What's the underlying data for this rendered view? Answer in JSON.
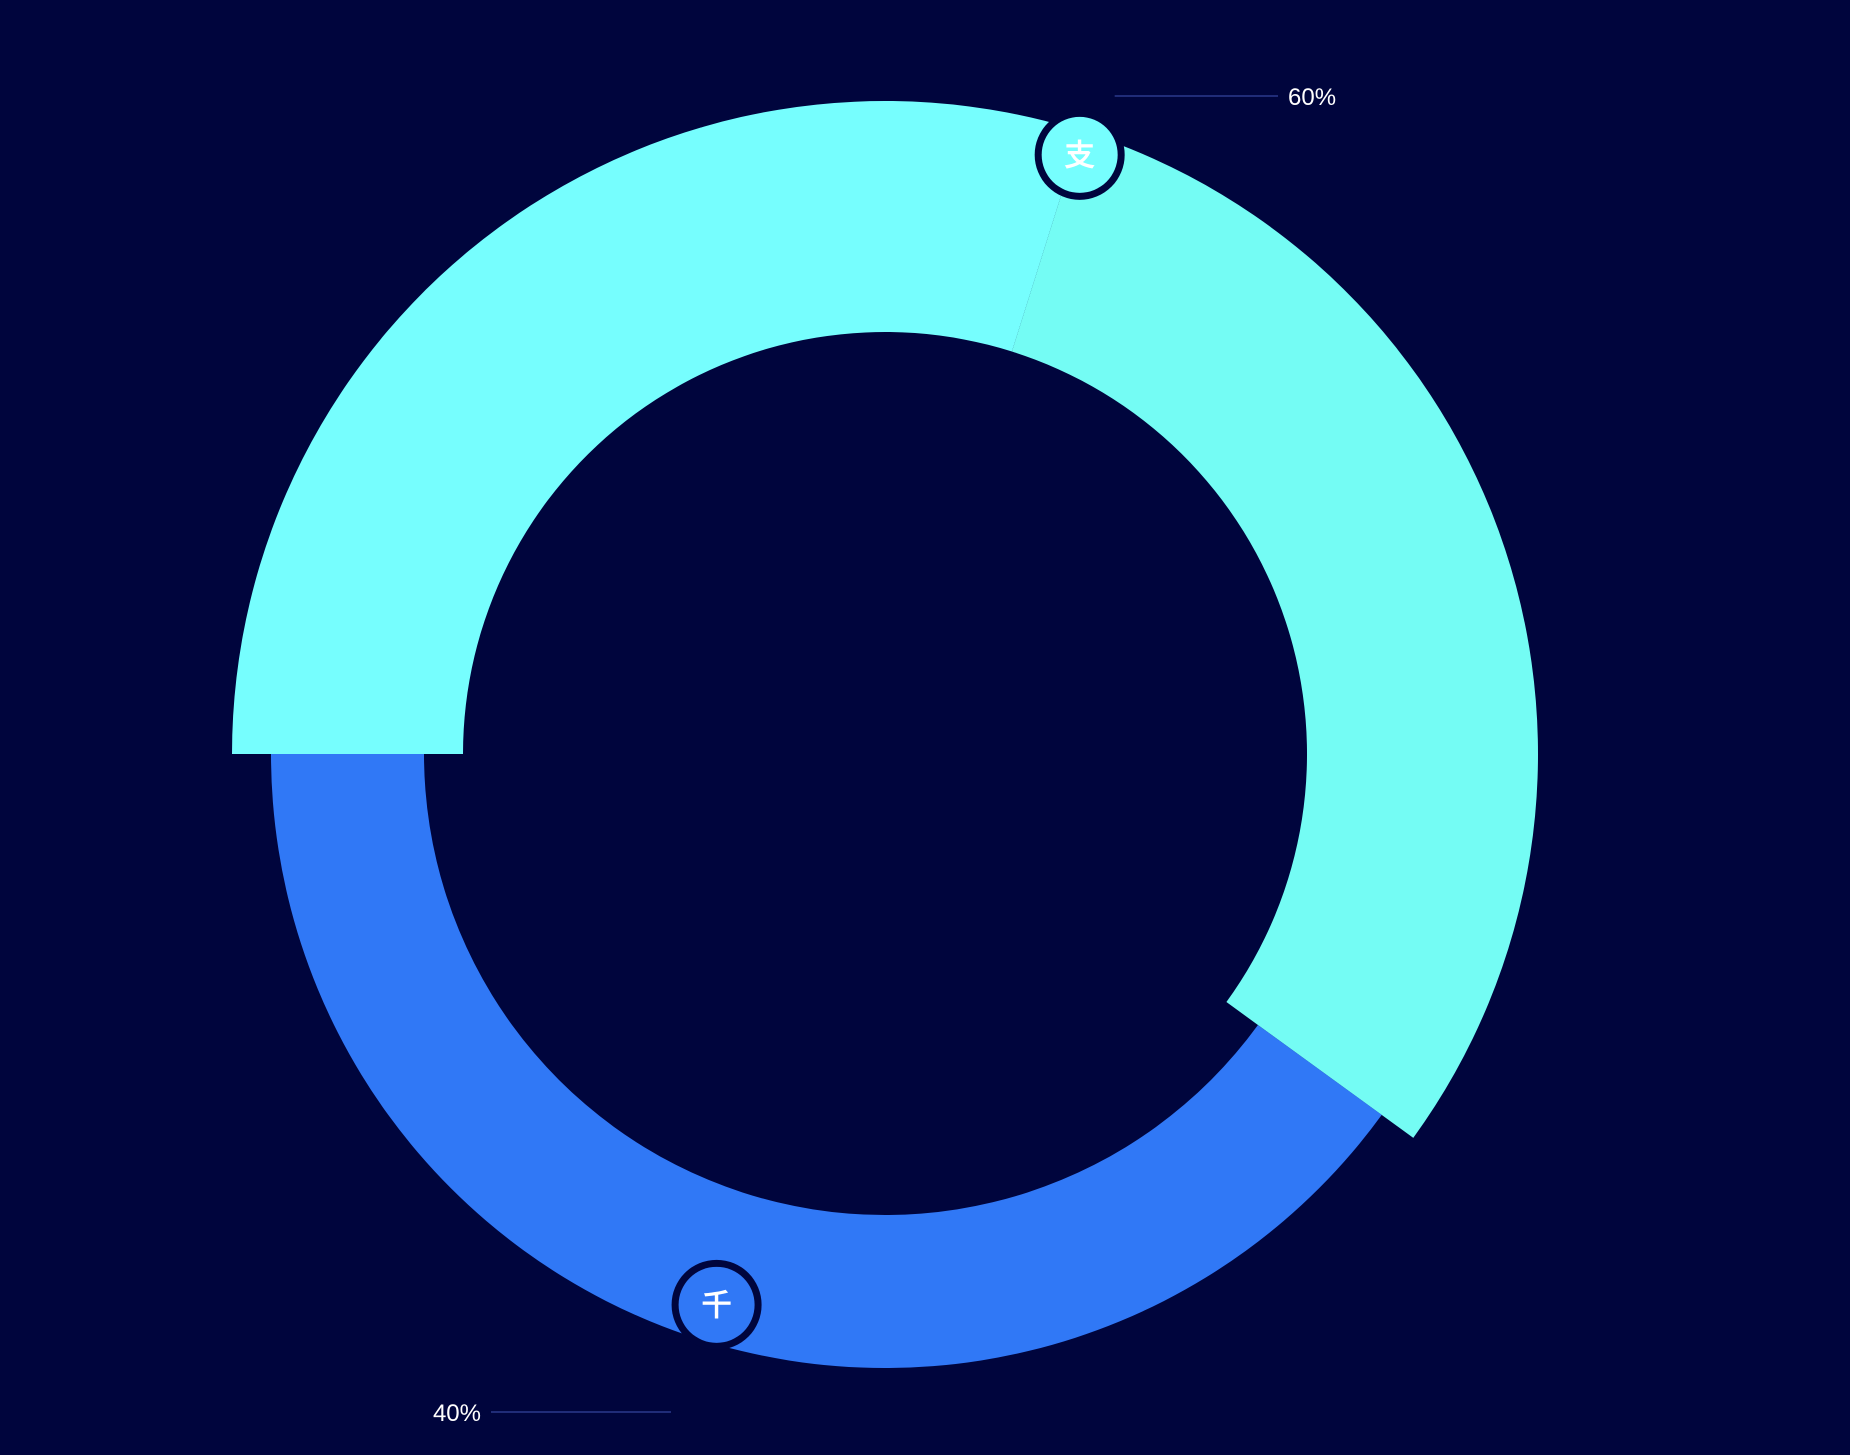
{
  "chart_data": {
    "type": "pie",
    "background": "#00053d",
    "slices": [
      {
        "value": 60,
        "label": "60%",
        "icon_char": "支",
        "color": "#76fefe",
        "color_inner": "#74fcf4"
      },
      {
        "value": 40,
        "label": "40%",
        "icon_char": "千",
        "color": "#3078f6"
      }
    ]
  }
}
